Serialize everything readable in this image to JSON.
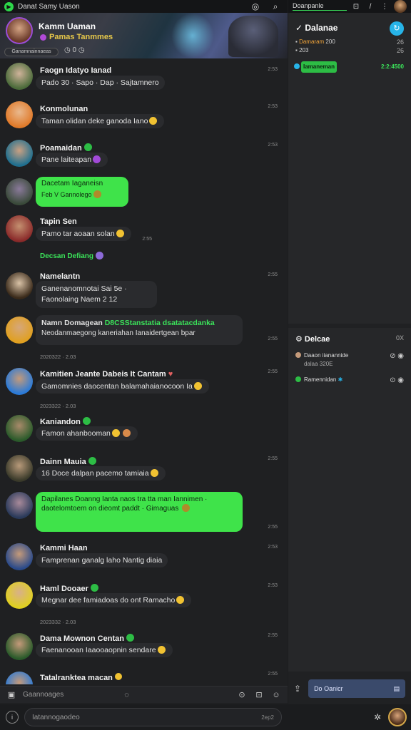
{
  "topbar": {
    "title": "Danat Samy Uason",
    "icons": [
      "compass-icon",
      "search-icon"
    ]
  },
  "banner": {
    "name": "Kamm Uaman",
    "subtitle": "Pamas Tanmmes",
    "pill": "Ganamnainnaeas",
    "controls": "◷ 0 ◷"
  },
  "messages": [
    {
      "name": "Faogn Idatyo Ianad",
      "text": "Pado 30 · Sapo · Dap · Sajtamnero",
      "time": "2:53",
      "green": false
    },
    {
      "name": "Konmolunan",
      "text": "Taman olidan deke ganoda Iano",
      "time": "2:53",
      "green": false
    },
    {
      "name": "Poamaidan",
      "text": "Pane laiteapan",
      "time": "2:53",
      "green": false
    },
    {
      "name": "Dacetam Iaganeisn",
      "text": "Feb V  Gannolego",
      "time": "",
      "green": true
    },
    {
      "name": "Tapin Sen",
      "text": "Pamo tar aoaan solan",
      "time": "2:55",
      "green": false
    },
    {
      "name": "Namelantn",
      "text": "Ganenanomnotai Sai 5e · Faonolaing Naem 2 12",
      "time": "2:55",
      "green": false
    },
    {
      "name": "Namn Domagean",
      "text": "Neodanmaegong kaneriahan Ianaidertgean bpar",
      "time": "2:55",
      "green": false
    },
    {
      "name": "Kamitien Jeante Dabeis It Cantam",
      "text": "Gamomnies daocentan balamahaianocoon Ia",
      "time": "2:55",
      "green": false
    },
    {
      "name": "Kaniandon",
      "text": "Famon ahanbooman",
      "time": "",
      "green": false
    },
    {
      "name": "Dainn Mauia",
      "text": "16 Doce dalpan pacemo tamiaia",
      "time": "2:55",
      "green": false
    },
    {
      "name": "",
      "text": "Dapilanes Doanng Ianta naos tra tta man Iannimen · daotelomtoem on dieomt paddt · Gimaguas",
      "time": "2:55",
      "green": true
    },
    {
      "name": "Kammi Haan",
      "text": "Famprenan ganalg laho Nantig diaia",
      "time": "2:53",
      "green": false
    },
    {
      "name": "Haml Dooaer",
      "text": "Megnar dee famiadoas do ont Ramacho",
      "time": "2:53",
      "green": false
    },
    {
      "name": "Dama Mownon Centan",
      "text": "Faenanooan Iaaooaopnin sendare",
      "time": "2:55",
      "green": false
    },
    {
      "name": "Tatalranktea macan",
      "text": "",
      "time": "2:55",
      "green": false
    }
  ],
  "extra": {
    "greenline": "Decsan Defiang",
    "name_suffix": "D8CSStanstatia dsatatacdanka",
    "sys1": "2020322 · 2.03",
    "sys2": "2023322 · 2.03",
    "sys3": "2023332 · 2.03",
    "heart": "♥"
  },
  "composer": {
    "placeholder_top": "Gaannoages",
    "placeholder_bottom": "Iatannogaodeo",
    "counter": "2ep2"
  },
  "right": {
    "tab": "Doanpanle",
    "panel1": {
      "title": "Dalanae",
      "line1_label": "Damaram",
      "line1_value": "200",
      "line2": "203",
      "small1": "26",
      "small2": "26",
      "green_button": "Iamaneman",
      "green_count": "2:2:4500"
    },
    "panel2": {
      "title": "Delcae",
      "close": "0X",
      "row1_line1": "Daaon iianannide",
      "row1_line2": "dalaa 320E",
      "row2": "Ramennidan"
    },
    "send": "Do Oanicr"
  },
  "colors": {
    "accent_green": "#3fe34a",
    "accent_blue": "#27b4e8",
    "background": "#1f2022"
  }
}
